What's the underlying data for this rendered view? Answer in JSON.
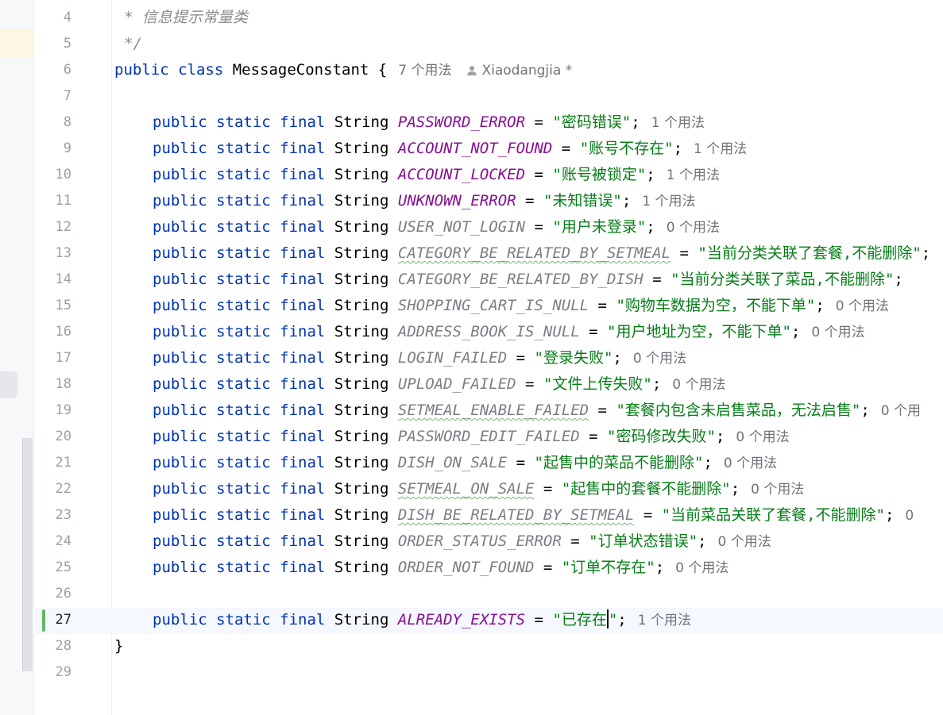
{
  "editor": {
    "header_comment": "* 信息提示常量类",
    "comment_close": "*/",
    "class_decl": {
      "modifiers": "public class",
      "name": "MessageConstant",
      "brace": "{",
      "usage_hint": "7 个用法",
      "author": "Xiaodangjia *"
    },
    "closing_brace": "}",
    "field_modifiers": "public static final",
    "field_type": "String",
    "line_numbers": [
      "4",
      "5",
      "6",
      "7",
      "8",
      "9",
      "10",
      "11",
      "12",
      "13",
      "14",
      "15",
      "16",
      "17",
      "18",
      "19",
      "20",
      "21",
      "22",
      "23",
      "24",
      "25",
      "26",
      "27",
      "28",
      "29"
    ],
    "fields": [
      {
        "name": "PASSWORD_ERROR",
        "value": "\"密码错误\"",
        "hint": "1 个用法"
      },
      {
        "name": "ACCOUNT_NOT_FOUND",
        "value": "\"账号不存在\"",
        "hint": "1 个用法"
      },
      {
        "name": "ACCOUNT_LOCKED",
        "value": "\"账号被锁定\"",
        "hint": "1 个用法"
      },
      {
        "name": "UNKNOWN_ERROR",
        "value": "\"未知错误\"",
        "hint": "1 个用法"
      },
      {
        "name": "USER_NOT_LOGIN",
        "value": "\"用户未登录\"",
        "hint": "0 个用法"
      },
      {
        "name": "CATEGORY_BE_RELATED_BY_SETMEAL",
        "value": "\"当前分类关联了套餐,不能删除\"",
        "hint": ""
      },
      {
        "name": "CATEGORY_BE_RELATED_BY_DISH",
        "value": "\"当前分类关联了菜品,不能删除\"",
        "hint": ""
      },
      {
        "name": "SHOPPING_CART_IS_NULL",
        "value": "\"购物车数据为空，不能下单\"",
        "hint": "0 个用法"
      },
      {
        "name": "ADDRESS_BOOK_IS_NULL",
        "value": "\"用户地址为空，不能下单\"",
        "hint": "0 个用法"
      },
      {
        "name": "LOGIN_FAILED",
        "value": "\"登录失败\"",
        "hint": "0 个用法"
      },
      {
        "name": "UPLOAD_FAILED",
        "value": "\"文件上传失败\"",
        "hint": "0 个用法"
      },
      {
        "name": "SETMEAL_ENABLE_FAILED",
        "value": "\"套餐内包含未启售菜品，无法启售\"",
        "hint": "0 个用"
      },
      {
        "name": "PASSWORD_EDIT_FAILED",
        "value": "\"密码修改失败\"",
        "hint": "0 个用法"
      },
      {
        "name": "DISH_ON_SALE",
        "value": "\"起售中的菜品不能删除\"",
        "hint": "0 个用法"
      },
      {
        "name": "SETMEAL_ON_SALE",
        "value": "\"起售中的套餐不能删除\"",
        "hint": "0 个用法"
      },
      {
        "name": "DISH_BE_RELATED_BY_SETMEAL",
        "value": "\"当前菜品关联了套餐,不能删除\"",
        "hint": "0"
      },
      {
        "name": "ORDER_STATUS_ERROR",
        "value": "\"订单状态错误\"",
        "hint": "0 个用法"
      },
      {
        "name": "ORDER_NOT_FOUND",
        "value": "\"订单不存在\"",
        "hint": "0 个用法"
      }
    ],
    "last_field": {
      "name": "ALREADY_EXISTS",
      "value_before_caret": "\"已存在",
      "value_after_caret": "\"",
      "hint": "1 个用法"
    },
    "colors": {
      "keyword": "#0033b3",
      "used_constant": "#871094",
      "unused_constant": "#7a7e85",
      "string": "#067d17",
      "comment": "#8c8c8c",
      "change_marker": "#5fb865"
    }
  }
}
